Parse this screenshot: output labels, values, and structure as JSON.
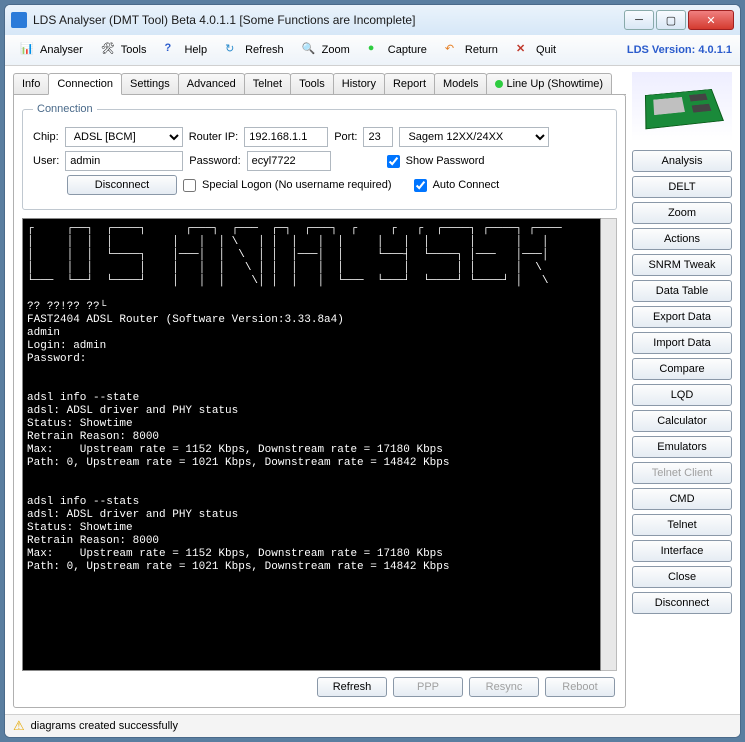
{
  "window": {
    "title": "LDS Analyser (DMT Tool) Beta 4.0.1.1 [Some Functions are Incomplete]"
  },
  "toolbar": {
    "analyser": "Analyser",
    "tools": "Tools",
    "help": "Help",
    "refresh": "Refresh",
    "zoom": "Zoom",
    "capture": "Capture",
    "return": "Return",
    "quit": "Quit",
    "version": "LDS Version: 4.0.1.1"
  },
  "tabs": [
    "Info",
    "Connection",
    "Settings",
    "Advanced",
    "Telnet",
    "Tools",
    "History",
    "Report",
    "Models",
    "Line Up (Showtime)"
  ],
  "active_tab": "Connection",
  "conn": {
    "legend": "Connection",
    "chip_label": "Chip:",
    "chip_value": "ADSL [BCM]",
    "router_ip_label": "Router IP:",
    "router_ip_value": "192.168.1.1",
    "port_label": "Port:",
    "port_value": "23",
    "modem_value": "Sagem 12XX/24XX",
    "user_label": "User:",
    "user_value": "admin",
    "password_label": "Password:",
    "password_value": "ecyl7722",
    "show_password": "Show Password",
    "disconnect": "Disconnect",
    "special_logon": "Special Logon (No username required)",
    "auto_connect": "Auto Connect"
  },
  "terminal": "┌     ┌──┐  ┌────┐      ┌───┐  ┌───  ┌─┐  ┌───┐  ┌     ┌   ┌  ┌────┐ ┌────┐ ┌──── \n│     │  │  │         │   │  │ \\   │ │  │   │  │     │   │  │      │      │   │\n│     │  │  └────┐    │───│  │  \\  │ │  │───│  │     └───┤  └────┐ │───   │───│\n│     │  │       │    │   │  │   \\ │ │  │   │  │         │       │ │      │  \\ \n└───  └──┘  └────┘    │   │  │    \\│ │  │   │  └───  └───┘  └────┘ └────┘ │   \\\n\n?? ??!?? ??└\nFAST2404 ADSL Router (Software Version:3.33.8a4)\nadmin\nLogin: admin\nPassword:\n\n\nadsl info --state\nadsl: ADSL driver and PHY status\nStatus: Showtime\nRetrain Reason: 8000\nMax:    Upstream rate = 1152 Kbps, Downstream rate = 17180 Kbps\nPath: 0, Upstream rate = 1021 Kbps, Downstream rate = 14842 Kbps\n\n\nadsl info --stats\nadsl: ADSL driver and PHY status\nStatus: Showtime\nRetrain Reason: 8000\nMax:    Upstream rate = 1152 Kbps, Downstream rate = 17180 Kbps\nPath: 0, Upstream rate = 1021 Kbps, Downstream rate = 14842 Kbps",
  "bottom": {
    "refresh": "Refresh",
    "ppp": "PPP",
    "resync": "Resync",
    "reboot": "Reboot"
  },
  "side": [
    "Analysis",
    "DELT",
    "Zoom",
    "Actions",
    "SNRM Tweak",
    "Data Table",
    "Export Data",
    "Import Data",
    "Compare",
    "LQD",
    "Calculator",
    "Emulators",
    "Telnet Client",
    "CMD",
    "Telnet",
    "Interface",
    "Close",
    "Disconnect"
  ],
  "side_disabled": [
    "Telnet Client"
  ],
  "status": "diagrams created successfully"
}
